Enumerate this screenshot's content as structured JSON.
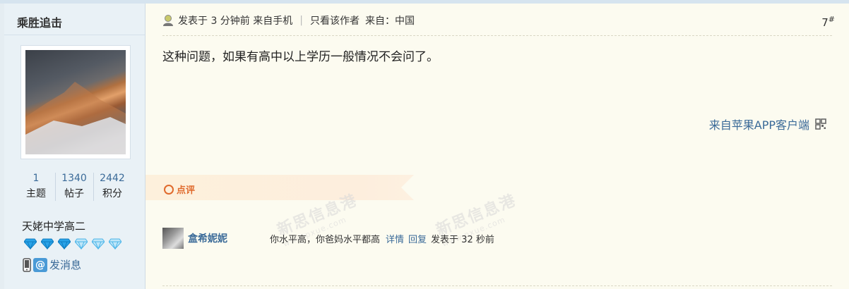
{
  "user": {
    "name": "乘胜追击",
    "stats": [
      {
        "num": "1",
        "label": "主题"
      },
      {
        "num": "1340",
        "label": "帖子"
      },
      {
        "num": "2442",
        "label": "积分"
      }
    ],
    "school": "天姥中学高二",
    "gems": [
      "gem-filled",
      "gem-filled",
      "gem-filled",
      "gem-empty",
      "gem-empty",
      "gem-empty"
    ],
    "send_message": "发消息"
  },
  "post": {
    "meta_posted": "发表于 3 分钟前 来自手机",
    "meta_separator": "|",
    "meta_only_author": "只看该作者",
    "meta_from": "来自：中国",
    "floor": "7",
    "floor_mark": "#",
    "content": "这种问题，如果有高中以上学历一般情况不会问了。",
    "from_app": "来自苹果APP客户端"
  },
  "comments": {
    "section_label": "点评",
    "items": [
      {
        "author": "盒希妮妮",
        "text": "你水平高，你爸妈水平都高",
        "detail_link": "详情",
        "reply_link": "回复",
        "time": "发表于 32 秒前"
      }
    ]
  },
  "colors": {
    "link": "#3a6a98",
    "comment_accent": "#e06a2c",
    "post_bg": "#fcfbf0",
    "sidebar_bg": "#e9f1f6"
  }
}
